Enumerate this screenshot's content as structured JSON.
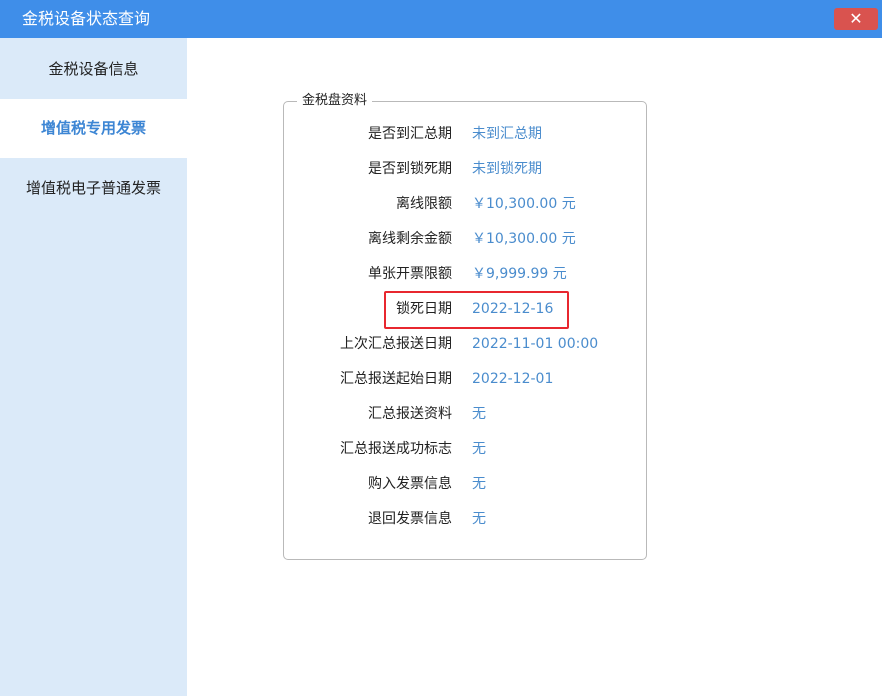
{
  "window": {
    "title": "金税设备状态查询",
    "close_label": "✕"
  },
  "sidebar": {
    "items": [
      {
        "label": "金税设备信息",
        "active": false
      },
      {
        "label": "增值税专用发票",
        "active": true
      },
      {
        "label": "增值税电子普通发票",
        "active": false
      }
    ]
  },
  "panel": {
    "legend": "金税盘资料",
    "rows": [
      {
        "label": "是否到汇总期",
        "value": "未到汇总期"
      },
      {
        "label": "是否到锁死期",
        "value": "未到锁死期"
      },
      {
        "label": "离线限额",
        "value": "￥10,300.00 元"
      },
      {
        "label": "离线剩余金额",
        "value": "￥10,300.00 元"
      },
      {
        "label": "单张开票限额",
        "value": "￥9,999.99 元"
      },
      {
        "label": "锁死日期",
        "value": "2022-12-16"
      },
      {
        "label": "上次汇总报送日期",
        "value": "2022-11-01 00:00"
      },
      {
        "label": "汇总报送起始日期",
        "value": "2022-12-01"
      },
      {
        "label": "汇总报送资料",
        "value": "无"
      },
      {
        "label": "汇总报送成功标志",
        "value": "无"
      },
      {
        "label": "购入发票信息",
        "value": "无"
      },
      {
        "label": "退回发票信息",
        "value": "无"
      }
    ]
  },
  "colors": {
    "titlebar": "#3f8ee9",
    "sidebar": "#dbeaf9",
    "active_text": "#3d86d4",
    "value_text": "#4a8ccd",
    "highlight_border": "#e8272f",
    "close_button": "#d9534f"
  }
}
